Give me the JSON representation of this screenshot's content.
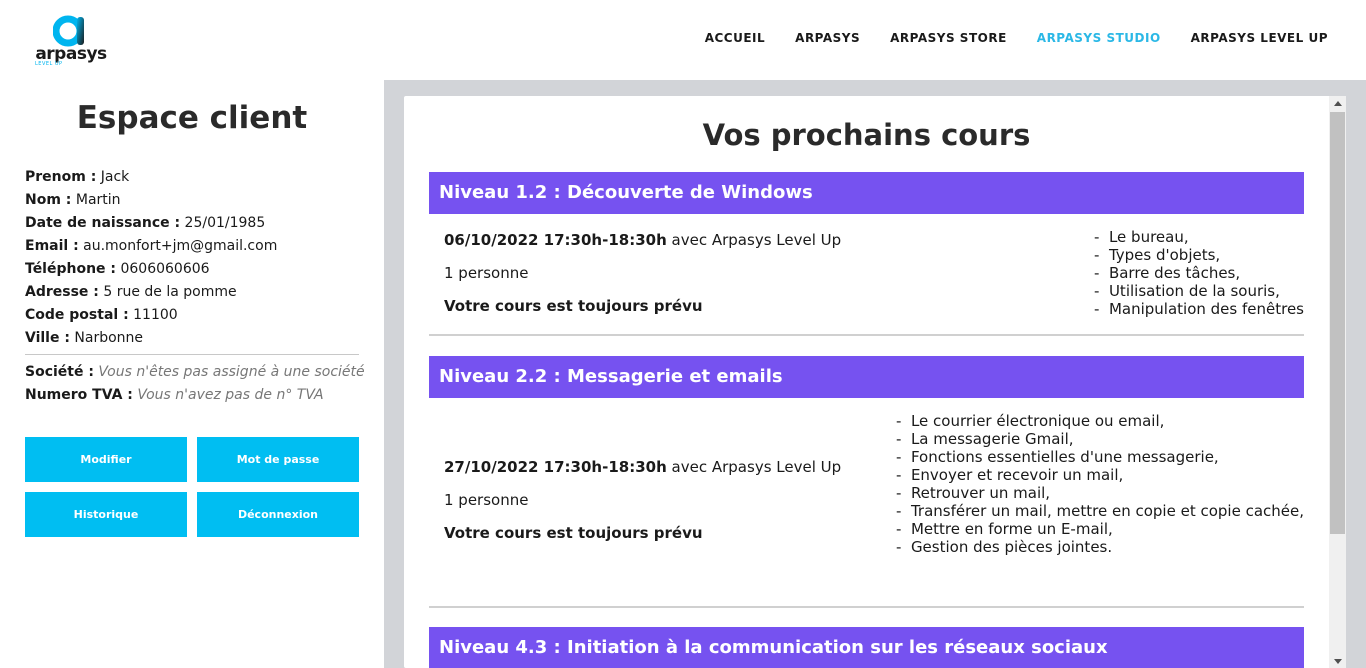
{
  "header": {
    "logo_text": "arpasys",
    "logo_sub": "LEVEL UP",
    "nav": [
      {
        "label": "ACCUEIL"
      },
      {
        "label": "ARPASYS"
      },
      {
        "label": "ARPASYS STORE"
      },
      {
        "label": "ARPASYS STUDIO"
      },
      {
        "label": "ARPASYS LEVEL UP"
      }
    ],
    "active_nav": "ARPASYS STUDIO",
    "accent_color": "#2bb8e6"
  },
  "sidebar": {
    "title": "Espace client",
    "fields": [
      {
        "label": "Prenom :",
        "value": "Jack"
      },
      {
        "label": "Nom :",
        "value": "Martin"
      },
      {
        "label": "Date de naissance :",
        "value": "25/01/1985"
      },
      {
        "label": "Email :",
        "value": "au.monfort+jm@gmail.com"
      },
      {
        "label": "Téléphone :",
        "value": "0606060606"
      },
      {
        "label": "Adresse :",
        "value": "5 rue de la pomme"
      },
      {
        "label": "Code postal :",
        "value": "11100"
      },
      {
        "label": "Ville :",
        "value": "Narbonne"
      }
    ],
    "company": {
      "label": "Société :",
      "value": "Vous n'êtes pas assigné à une société"
    },
    "vat": {
      "label": "Numero TVA :",
      "value": "Vous n'avez pas de n° TVA"
    },
    "buttons": {
      "modify": "Modifier",
      "password": "Mot de passe",
      "history": "Historique",
      "logout": "Déconnexion"
    },
    "button_color": "#00bef2"
  },
  "main": {
    "title": "Vos prochains cours",
    "header_color": "#7652f0",
    "courses": [
      {
        "title": "Niveau 1.2 : Découverte de Windows",
        "datetime": "06/10/2022 17:30h-18:30h",
        "with": "avec Arpasys Level Up",
        "people": "1 personne",
        "status": "Votre cours est toujours prévu",
        "topics": [
          "Le bureau,",
          "Types d'objets,",
          "Barre des tâches,",
          "Utilisation de la souris,",
          "Manipulation des fenêtres"
        ]
      },
      {
        "title": "Niveau 2.2 : Messagerie et emails",
        "datetime": "27/10/2022 17:30h-18:30h",
        "with": "avec Arpasys Level Up",
        "people": "1 personne",
        "status": "Votre cours est toujours prévu",
        "topics": [
          "Le courrier électronique ou email,",
          "La messagerie Gmail,",
          "Fonctions essentielles d'une messagerie,",
          "Envoyer et recevoir un mail,",
          "Retrouver un mail,",
          "Transférer un mail, mettre en copie et copie cachée,",
          "Mettre en forme un E-mail,",
          "Gestion des pièces jointes."
        ]
      },
      {
        "title": "Niveau 4.3 : Initiation à la communication sur les réseaux sociaux"
      }
    ]
  }
}
